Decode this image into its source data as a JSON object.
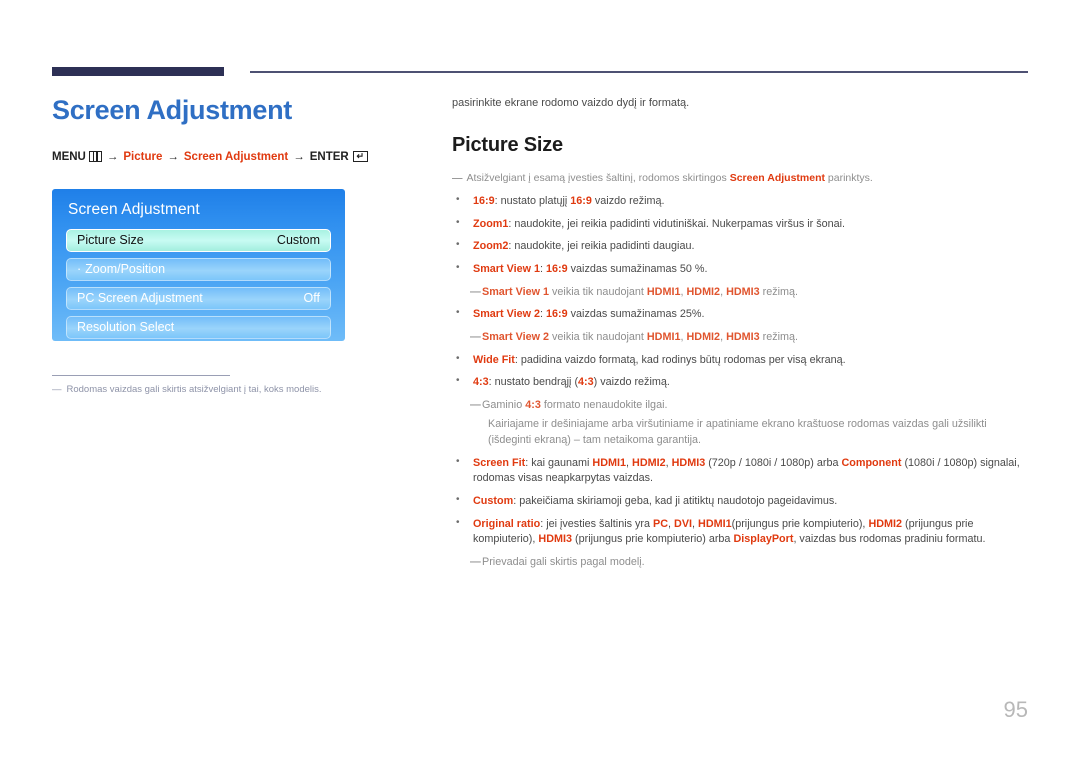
{
  "page": {
    "number": "95",
    "accent_blue": "#2f6fc4",
    "accent_red": "#e03a10",
    "rule_navy": "#2d3055"
  },
  "left": {
    "title": "Screen Adjustment",
    "menu_path": {
      "menu_label": "MENU",
      "menu_icon": "menu-bars-icon",
      "arrow": "→",
      "item1": "Picture",
      "item2": "Screen Adjustment",
      "enter_label": "ENTER",
      "enter_icon": "enter-return-icon",
      "enter_glyph": "↵"
    },
    "osd": {
      "title": "Screen Adjustment",
      "rows": [
        {
          "label": "Picture Size",
          "value": "Custom",
          "selected": true,
          "sub": false
        },
        {
          "label": "Zoom/Position",
          "value": "",
          "selected": false,
          "sub": true
        },
        {
          "label": "PC Screen Adjustment",
          "value": "Off",
          "selected": false,
          "sub": false
        },
        {
          "label": "Resolution Select",
          "value": "",
          "selected": false,
          "sub": false
        }
      ]
    },
    "footnote": {
      "dash": "―",
      "text": "Rodomas vaizdas gali skirtis atsižvelgiant į tai, koks modelis."
    }
  },
  "right": {
    "intro": "pasirinkite ekrane rodomo vaizdo dydį ir formatą.",
    "heading": "Picture Size",
    "head_note": {
      "dash": "―",
      "pre": "Atsižvelgiant į esamą įvesties šaltinį, rodomos skirtingos ",
      "kw": "Screen Adjustment",
      "post": " parinktys."
    },
    "bullets": [
      {
        "type": "bullet",
        "parts": [
          {
            "t": "kw",
            "v": "16:9"
          },
          {
            "t": "txt",
            "v": ": nustato platųjį "
          },
          {
            "t": "kw",
            "v": "16:9"
          },
          {
            "t": "txt",
            "v": " vaizdo režimą."
          }
        ]
      },
      {
        "type": "bullet",
        "parts": [
          {
            "t": "kw",
            "v": "Zoom1"
          },
          {
            "t": "txt",
            "v": ": naudokite, jei reikia padidinti vidutiniškai. Nukerpamas viršus ir šonai."
          }
        ]
      },
      {
        "type": "bullet",
        "parts": [
          {
            "t": "kw",
            "v": "Zoom2"
          },
          {
            "t": "txt",
            "v": ": naudokite, jei reikia padidinti daugiau."
          }
        ]
      },
      {
        "type": "bullet",
        "parts": [
          {
            "t": "kw",
            "v": "Smart View 1"
          },
          {
            "t": "txt",
            "v": ": "
          },
          {
            "t": "kw",
            "v": "16:9"
          },
          {
            "t": "txt",
            "v": " vaizdas sumažinamas 50 %."
          }
        ]
      },
      {
        "type": "subnote",
        "dash": "―",
        "parts": [
          {
            "t": "kw",
            "v": "Smart View 1"
          },
          {
            "t": "txt",
            "v": " veikia tik naudojant "
          },
          {
            "t": "kw",
            "v": "HDMI1"
          },
          {
            "t": "txt",
            "v": ", "
          },
          {
            "t": "kw",
            "v": "HDMI2"
          },
          {
            "t": "txt",
            "v": ", "
          },
          {
            "t": "kw",
            "v": "HDMI3"
          },
          {
            "t": "txt",
            "v": " režimą."
          }
        ]
      },
      {
        "type": "bullet",
        "parts": [
          {
            "t": "kw",
            "v": "Smart View 2"
          },
          {
            "t": "txt",
            "v": ": "
          },
          {
            "t": "kw",
            "v": "16:9"
          },
          {
            "t": "txt",
            "v": " vaizdas sumažinamas 25%."
          }
        ]
      },
      {
        "type": "subnote",
        "dash": "―",
        "parts": [
          {
            "t": "kw",
            "v": "Smart View 2"
          },
          {
            "t": "txt",
            "v": " veikia tik naudojant "
          },
          {
            "t": "kw",
            "v": "HDMI1"
          },
          {
            "t": "txt",
            "v": ", "
          },
          {
            "t": "kw",
            "v": "HDMI2"
          },
          {
            "t": "txt",
            "v": ", "
          },
          {
            "t": "kw",
            "v": "HDMI3"
          },
          {
            "t": "txt",
            "v": " režimą."
          }
        ]
      },
      {
        "type": "bullet",
        "parts": [
          {
            "t": "kw",
            "v": "Wide Fit"
          },
          {
            "t": "txt",
            "v": ": padidina vaizdo formatą, kad rodinys būtų rodomas per visą ekraną."
          }
        ]
      },
      {
        "type": "bullet",
        "parts": [
          {
            "t": "kw",
            "v": "4:3"
          },
          {
            "t": "txt",
            "v": ": nustato bendrąjį ("
          },
          {
            "t": "kw",
            "v": "4:3"
          },
          {
            "t": "txt",
            "v": ") vaizdo režimą."
          }
        ]
      },
      {
        "type": "subnote",
        "dash": "―",
        "parts": [
          {
            "t": "txt",
            "v": "Gaminio "
          },
          {
            "t": "kw",
            "v": "4:3"
          },
          {
            "t": "txt",
            "v": " formato nenaudokite ilgai."
          }
        ]
      },
      {
        "type": "subnote-deep",
        "parts": [
          {
            "t": "txt",
            "v": "Kairiajame ir dešiniajame arba viršutiniame ir apatiniame ekrano kraštuose rodomas vaizdas gali užsilikti (išdeginti ekraną) – tam netaikoma garantija."
          }
        ]
      },
      {
        "type": "bullet",
        "parts": [
          {
            "t": "kw",
            "v": "Screen Fit"
          },
          {
            "t": "txt",
            "v": ": kai gaunami "
          },
          {
            "t": "kw",
            "v": "HDMI1"
          },
          {
            "t": "txt",
            "v": ", "
          },
          {
            "t": "kw",
            "v": "HDMI2"
          },
          {
            "t": "txt",
            "v": ", "
          },
          {
            "t": "kw",
            "v": "HDMI3"
          },
          {
            "t": "txt",
            "v": " (720p / 1080i / 1080p) arba "
          },
          {
            "t": "kw",
            "v": "Component"
          },
          {
            "t": "txt",
            "v": " (1080i / 1080p) signalai, rodomas visas neapkarpytas vaizdas."
          }
        ]
      },
      {
        "type": "bullet",
        "parts": [
          {
            "t": "kw",
            "v": "Custom"
          },
          {
            "t": "txt",
            "v": ": pakeičiama skiriamoji geba, kad ji atitiktų naudotojo pageidavimus."
          }
        ]
      },
      {
        "type": "bullet",
        "parts": [
          {
            "t": "kw",
            "v": "Original ratio"
          },
          {
            "t": "txt",
            "v": ": jei įvesties šaltinis yra "
          },
          {
            "t": "kw",
            "v": "PC"
          },
          {
            "t": "txt",
            "v": ", "
          },
          {
            "t": "kw",
            "v": "DVI"
          },
          {
            "t": "txt",
            "v": ", "
          },
          {
            "t": "kw",
            "v": "HDMI1"
          },
          {
            "t": "txt",
            "v": "(prijungus prie kompiuterio), "
          },
          {
            "t": "kw",
            "v": "HDMI2"
          },
          {
            "t": "txt",
            "v": " (prijungus prie kompiuterio), "
          },
          {
            "t": "kw",
            "v": "HDMI3"
          },
          {
            "t": "txt",
            "v": " (prijungus prie kompiuterio) arba "
          },
          {
            "t": "kw",
            "v": "DisplayPort"
          },
          {
            "t": "txt",
            "v": ", vaizdas bus rodomas pradiniu formatu."
          }
        ]
      },
      {
        "type": "subnote",
        "dash": "―",
        "parts": [
          {
            "t": "txt",
            "v": "Prievadai gali skirtis pagal modelį."
          }
        ]
      }
    ]
  }
}
